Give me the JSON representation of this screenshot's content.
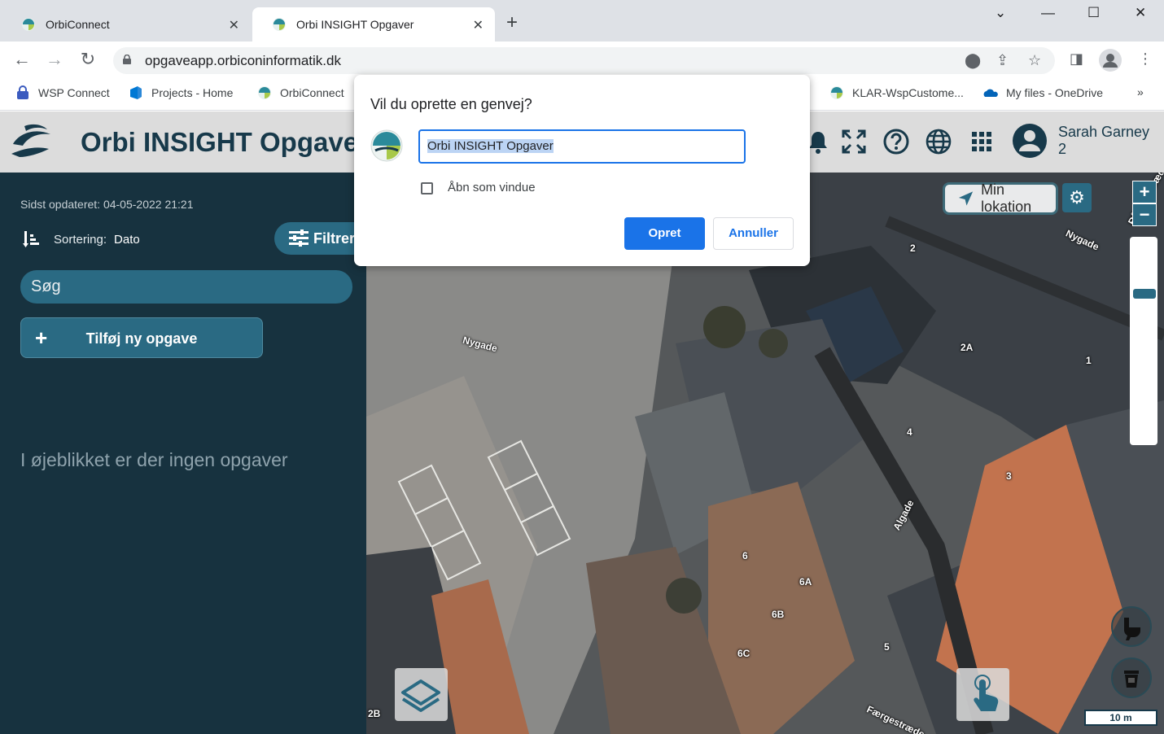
{
  "browser": {
    "tabs": [
      {
        "label": "OrbiConnect",
        "active": false
      },
      {
        "label": "Orbi INSIGHT Opgaver",
        "active": true
      }
    ],
    "url": "opgaveapp.orbiconinformatik.dk",
    "bookmarks": [
      {
        "label": "WSP Connect",
        "icon": "wsp-lock-icon"
      },
      {
        "label": "Projects - Home",
        "icon": "azure-devops-icon"
      },
      {
        "label": "OrbiConnect",
        "icon": "orbi-icon"
      },
      {
        "label": "KLAR-WspCustome...",
        "icon": "orbi-icon"
      },
      {
        "label": "My files - OneDrive",
        "icon": "onedrive-icon"
      }
    ],
    "bookmarks_overflow": "»"
  },
  "app": {
    "title": "Orbi INSIGHT Opgaver",
    "user_name": "Sarah Garney",
    "user_sub": "2",
    "colors": {
      "header_bg": "#dcdcdc",
      "sidebar_bg": "#17323f",
      "accent": "#2a6a83",
      "text_dark": "#17394a"
    }
  },
  "sidebar": {
    "last_updated": "Sidst opdateret: 04-05-2022 21:21",
    "sort_label": "Sortering:",
    "sort_value": "Dato",
    "filter_label": "Filtrer",
    "search_placeholder": "Søg",
    "add_task_label": "Tilføj ny opgave",
    "empty_message": "I øjeblikket er der ingen opgaver"
  },
  "map": {
    "my_location_label": "Min lokation",
    "zoom_in": "+",
    "zoom_out": "−",
    "scale_label": "10 m",
    "street_labels": [
      "Nygade",
      "Nygade",
      "Algade",
      "Færgestræde",
      "Rådhusstræde"
    ],
    "house_numbers": [
      "2",
      "2A",
      "1",
      "4",
      "3",
      "6",
      "6A",
      "6B",
      "6C",
      "5",
      "2B"
    ]
  },
  "dialog": {
    "title": "Vil du oprette en genvej?",
    "name_value": "Orbi INSIGHT Opgaver",
    "checkbox_label": "Åbn som vindue",
    "checkbox_checked": false,
    "confirm_label": "Opret",
    "cancel_label": "Annuller"
  }
}
